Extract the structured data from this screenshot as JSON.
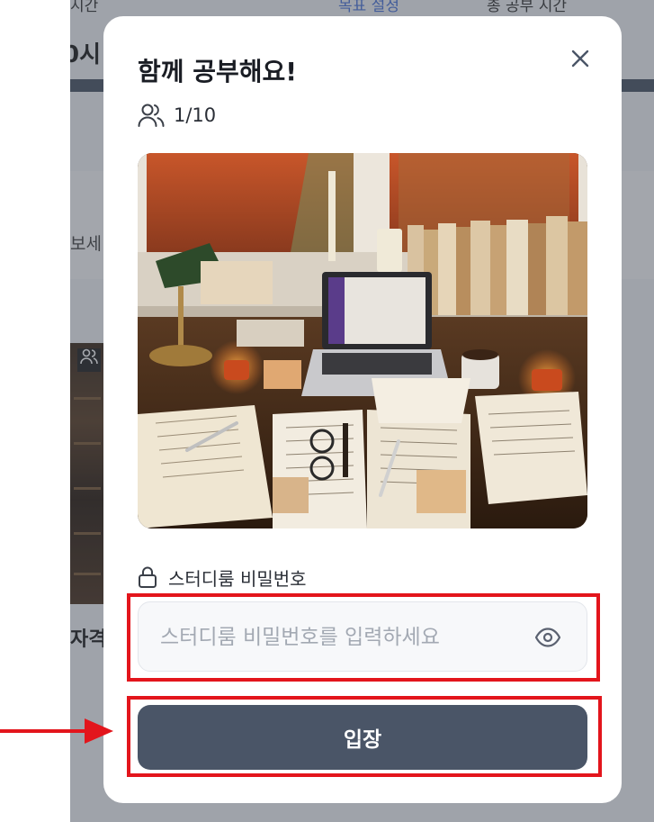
{
  "background": {
    "top_left_text": "시간",
    "top_link_text": "목표 설정",
    "top_right_text": "총 공부 시간",
    "stat_text": "0시",
    "card_text": "보세",
    "card_title": "자격"
  },
  "modal": {
    "title": "함께 공부해요!",
    "member_count": "1/10",
    "password_label": "스터디룸 비밀번호",
    "password_placeholder": "스터디룸 비밀번호를 입력하세요",
    "password_value": "",
    "enter_label": "입장",
    "icons": {
      "close": "close-icon",
      "members": "users-icon",
      "lock": "lock-icon",
      "visibility": "eye-icon"
    }
  },
  "colors": {
    "enter_button": "#4a5567",
    "highlight": "#e3151c",
    "input_background": "#f7f8fa"
  }
}
